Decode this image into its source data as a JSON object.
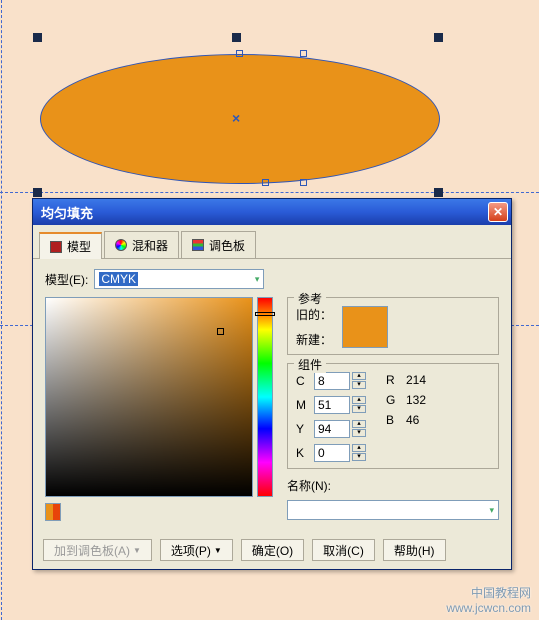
{
  "dialog": {
    "title": "均匀填充",
    "tabs": {
      "model": "模型",
      "mixer": "混和器",
      "palette": "调色板"
    },
    "model_label": "模型(E):",
    "model_value": "CMYK",
    "reference": {
      "title": "参考",
      "old_label": "旧的：",
      "new_label": "新建：",
      "color": "#e99219"
    },
    "components": {
      "title": "组件",
      "c_label": "C",
      "c_value": "8",
      "m_label": "M",
      "m_value": "51",
      "y_label": "Y",
      "y_value": "94",
      "k_label": "K",
      "k_value": "0",
      "r_label": "R",
      "r_value": "214",
      "g_label": "G",
      "g_value": "132",
      "b_label": "B",
      "b_value": "46"
    },
    "name_label": "名称(N):",
    "name_value": "",
    "buttons": {
      "add_palette": "加到调色板(A)",
      "options": "选项(P)",
      "ok": "确定(O)",
      "cancel": "取消(C)",
      "help": "帮助(H)"
    }
  },
  "watermark": {
    "line1": "中国教程网",
    "line2": "www.jcwcn.com"
  }
}
